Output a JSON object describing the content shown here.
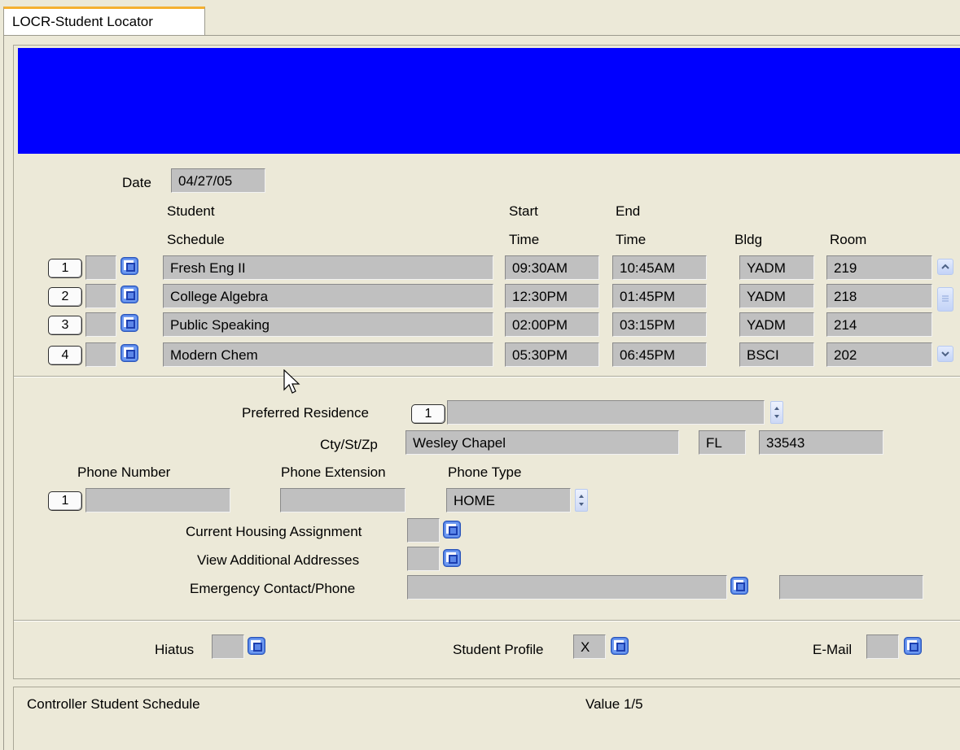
{
  "tab": {
    "title": "LOCR-Student Locator"
  },
  "colors": {
    "banner": "#0000ff",
    "field_bg": "#c0c0c0",
    "window_bg": "#ece9d8",
    "tab_accent": "#f5b031"
  },
  "date": {
    "label": "Date",
    "value": "04/27/05"
  },
  "schedule": {
    "headers": {
      "course_line1": "Student",
      "course_line2": "Schedule",
      "start_line1": "Start",
      "start_line2": "Time",
      "end_line1": "End",
      "end_line2": "Time",
      "bldg": "Bldg",
      "room": "Room"
    },
    "rows": [
      {
        "num": "1",
        "course": "Fresh Eng II",
        "start": "09:30AM",
        "end": "10:45AM",
        "bldg": "YADM",
        "room": "219"
      },
      {
        "num": "2",
        "course": "College Algebra",
        "start": "12:30PM",
        "end": "01:45PM",
        "bldg": "YADM",
        "room": "218"
      },
      {
        "num": "3",
        "course": "Public Speaking",
        "start": "02:00PM",
        "end": "03:15PM",
        "bldg": "YADM",
        "room": "214"
      },
      {
        "num": "4",
        "course": "Modern Chem",
        "start": "05:30PM",
        "end": "06:45PM",
        "bldg": "BSCI",
        "room": "202"
      }
    ]
  },
  "residence": {
    "label": "Preferred Residence",
    "num": "1",
    "value": "",
    "csz_label": "Cty/St/Zp",
    "city": "Wesley Chapel",
    "state": "FL",
    "zip": "33543"
  },
  "phone": {
    "number_label": "Phone Number",
    "ext_label": "Phone Extension",
    "type_label": "Phone Type",
    "num": "1",
    "number": "",
    "ext": "",
    "type": "HOME"
  },
  "housing": {
    "current_label": "Current Housing Assignment",
    "current_value": "",
    "additional_label": "View Additional Addresses",
    "additional_value": "",
    "emergency_label": "Emergency Contact/Phone",
    "emergency_contact": "",
    "emergency_phone": ""
  },
  "flags": {
    "hiatus_label": "Hiatus",
    "hiatus_value": "",
    "profile_label": "Student Profile",
    "profile_value": "X",
    "email_label": "E-Mail",
    "email_value": ""
  },
  "status": {
    "left": "Controller Student Schedule",
    "center": "Value 1/5"
  }
}
